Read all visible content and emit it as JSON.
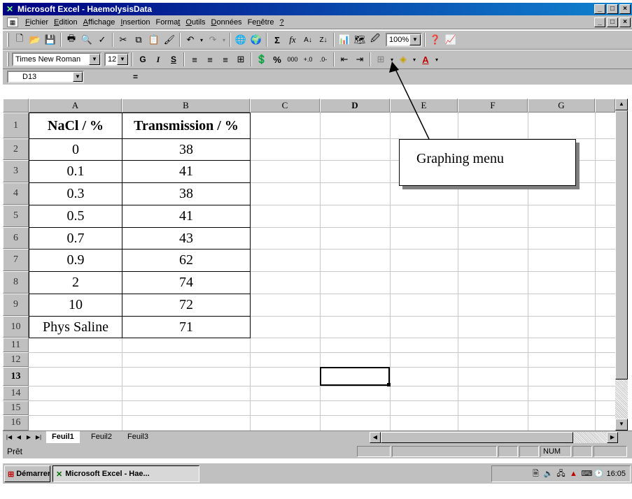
{
  "window": {
    "title": "Microsoft Excel - HaemolysisData",
    "minimize": "_",
    "maximize": "□",
    "close": "×"
  },
  "menubar": {
    "items": [
      {
        "label": "Fichier",
        "key": "F",
        "rest": "ichier"
      },
      {
        "label": "Edition",
        "key": "E",
        "rest": "dition"
      },
      {
        "label": "Affichage",
        "key": "A",
        "rest": "ffichage"
      },
      {
        "label": "Insertion",
        "key": "I",
        "rest": "nsertion"
      },
      {
        "label": "Format",
        "pre": "Forma",
        "key": "t",
        "rest": ""
      },
      {
        "label": "Outils",
        "key": "O",
        "rest": "utils"
      },
      {
        "label": "Données",
        "key": "D",
        "rest": "onnées"
      },
      {
        "label": "Fenêtre",
        "pre": "Fe",
        "key": "n",
        "rest": "être"
      },
      {
        "label": "?",
        "key": "?",
        "rest": ""
      }
    ]
  },
  "toolbar": {
    "zoom": "100%",
    "font_name": "Times New Roman",
    "font_size": "12",
    "bold": "G",
    "italic": "I",
    "underline": "S",
    "percent": "%",
    "thousands": "000"
  },
  "formula_bar": {
    "name_box": "D13",
    "equals": "="
  },
  "columns": [
    "A",
    "B",
    "C",
    "D",
    "E",
    "F",
    "G"
  ],
  "rows": [
    "1",
    "2",
    "3",
    "4",
    "5",
    "6",
    "7",
    "8",
    "9",
    "10",
    "11",
    "12",
    "13",
    "14",
    "15",
    "16"
  ],
  "table": {
    "headers": [
      "NaCl / %",
      "Transmission / %"
    ],
    "rows": [
      [
        "0",
        "38"
      ],
      [
        "0.1",
        "41"
      ],
      [
        "0.3",
        "38"
      ],
      [
        "0.5",
        "41"
      ],
      [
        "0.7",
        "43"
      ],
      [
        "0.9",
        "62"
      ],
      [
        "2",
        "74"
      ],
      [
        "10",
        "72"
      ],
      [
        "Phys Saline",
        "71"
      ]
    ]
  },
  "callout": {
    "text": "Graphing menu"
  },
  "sheet_tabs": [
    "Feuil1",
    "Feuil2",
    "Feuil3"
  ],
  "status": {
    "ready": "Prêt",
    "num": "NUM"
  },
  "taskbar": {
    "start": "Démarrer",
    "task": "Microsoft Excel - Hae...",
    "clock": "16:05"
  },
  "colors": {
    "title_start": "#000080",
    "title_end": "#1084d0",
    "chrome": "#c0c0c0"
  }
}
